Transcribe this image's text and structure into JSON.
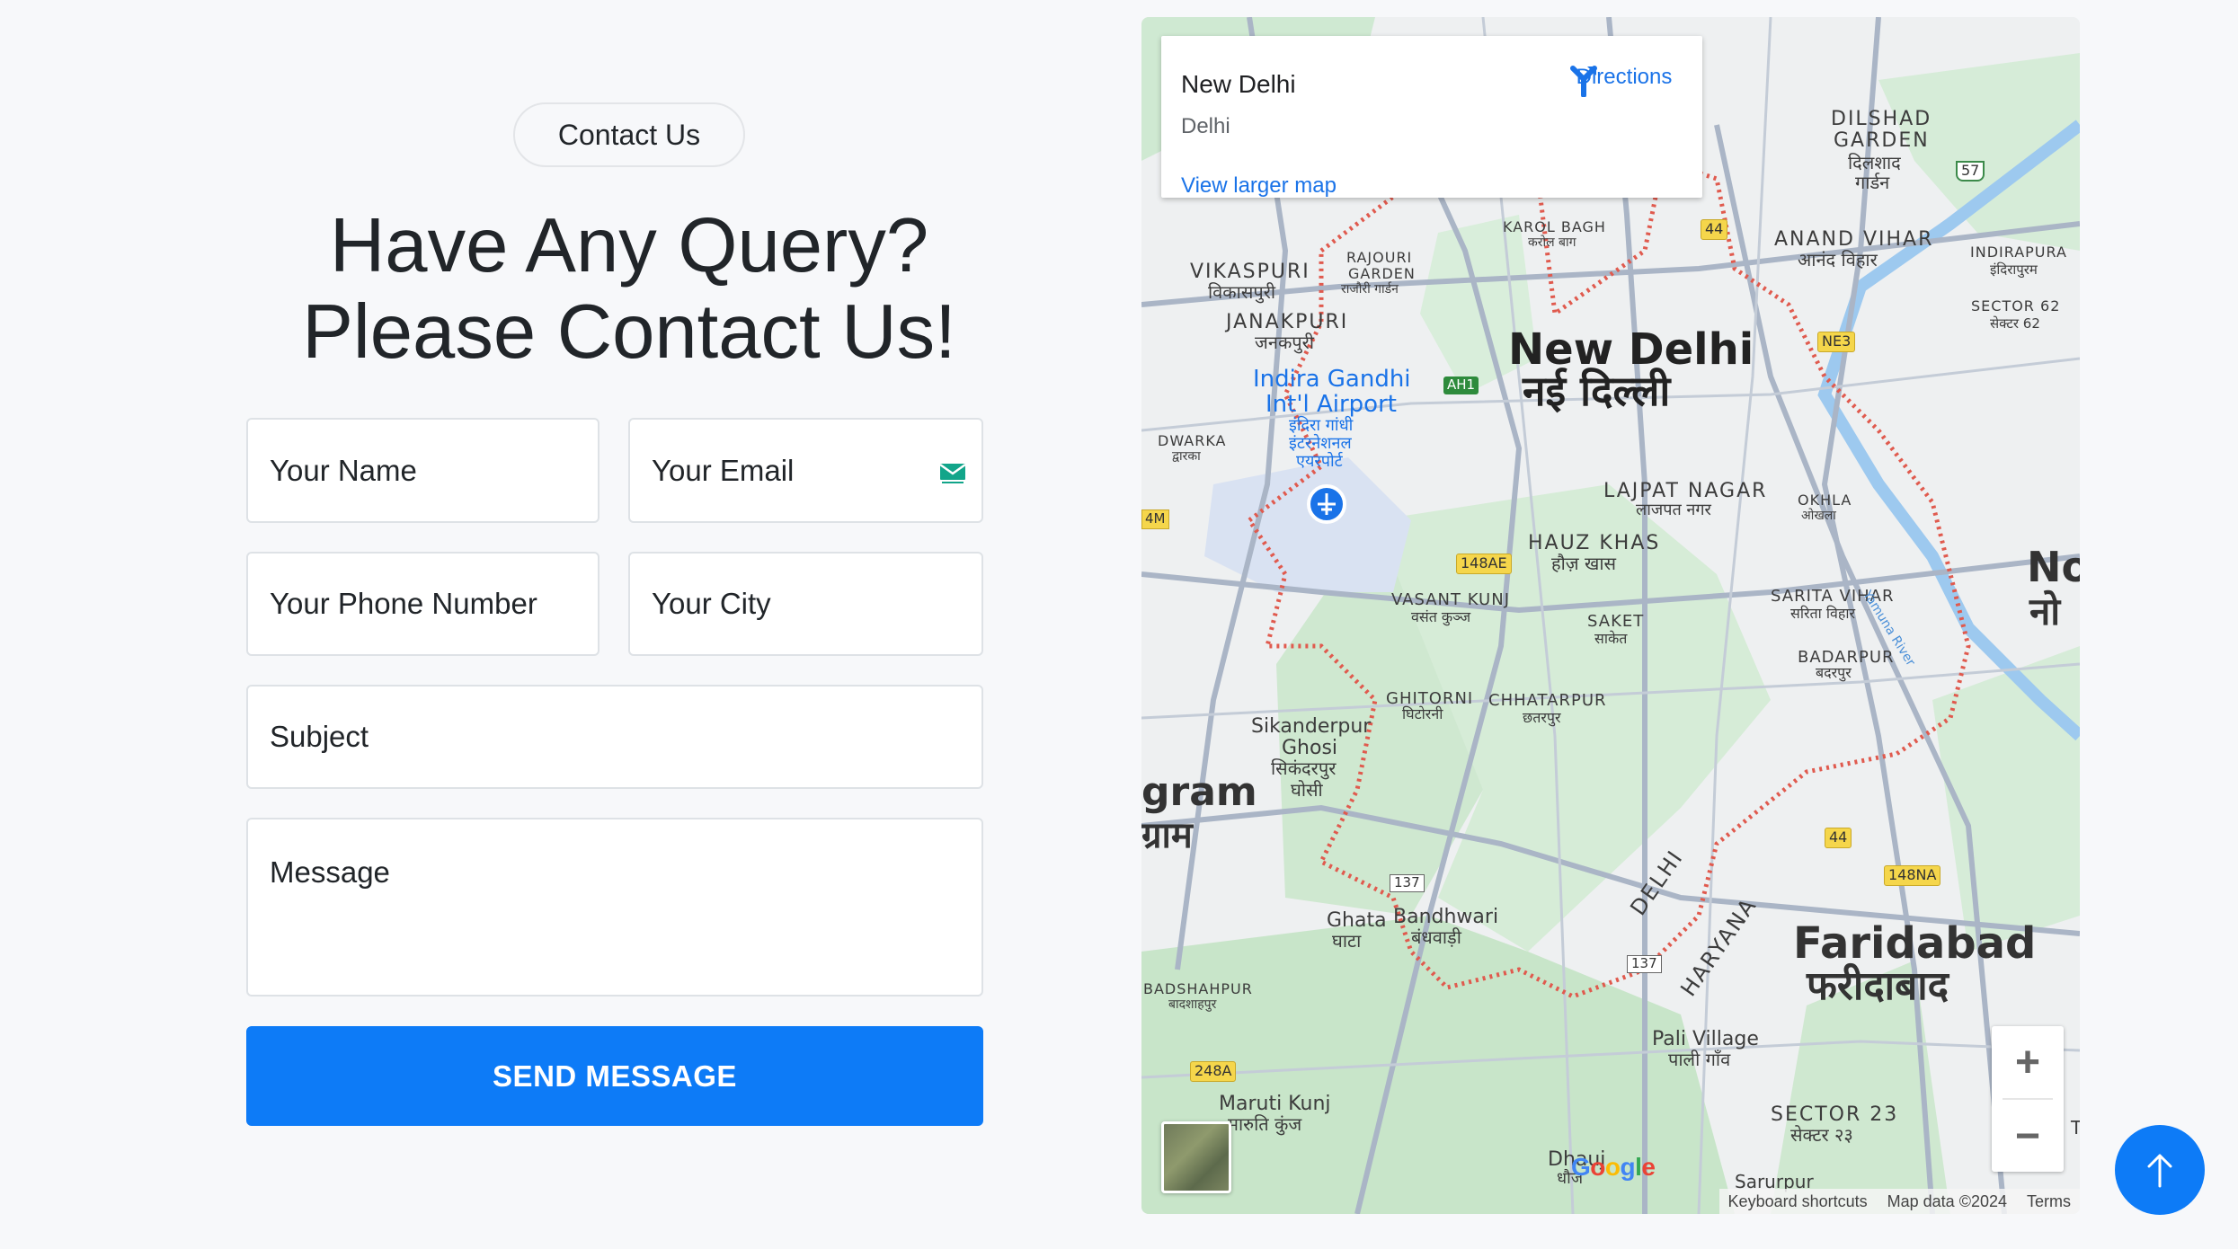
{
  "contact": {
    "badge": "Contact Us",
    "heading_line1": "Have Any Query?",
    "heading_line2": "Please Contact Us!"
  },
  "form": {
    "name_placeholder": "Your Name",
    "email_placeholder": "Your Email",
    "phone_placeholder": "Your Phone Number",
    "city_placeholder": "Your City",
    "subject_placeholder": "Subject",
    "message_placeholder": "Message",
    "email_field_icon": "mail-icon",
    "send_label": "SEND MESSAGE"
  },
  "map": {
    "place_title": "New Delhi",
    "place_subtitle": "Delhi",
    "view_larger": "View larger map",
    "directions_label": "Directions",
    "zoom_in": "+",
    "zoom_out": "−",
    "attribution": {
      "shortcuts": "Keyboard shortcuts",
      "data": "Map data ©2024",
      "terms": "Terms"
    },
    "google": "Google",
    "labels": {
      "new_delhi": "New Delhi",
      "new_delhi_hi": "नई दिल्ली",
      "faridabad": "Faridabad",
      "faridabad_hi": "फरीदाबाद",
      "gurgram": "gram",
      "gurgram_hi": "ग्राम",
      "noida": "No",
      "noida_hi": "नो",
      "dilshad": "DILSHAD",
      "garden": "GARDEN",
      "dilshad_hi": "दिलशाद",
      "garden_hi": "गार्डन",
      "anand_vihar": "ANAND VIHAR",
      "anand_vihar_hi": "आनंद विहार",
      "indirapura": "INDIRAPURA",
      "indirapura_hi": "इंदिरापुरम",
      "sector62": "SECTOR 62",
      "sector62_hi": "सेक्टर 62",
      "karol_bagh": "KAROL BAGH",
      "karol_bagh_hi": "करोल बाग",
      "vikaspuri": "VIKASPURI",
      "vikaspuri_hi": "विकासपुरी",
      "rajouri": "RAJOURI",
      "rajouri2": "GARDEN",
      "rajouri_hi": "राजौरी गार्डन",
      "janakpuri": "JANAKPURI",
      "janakpuri_hi": "जनकपुरी",
      "airport1": "Indira Gandhi",
      "airport2": "Int'l Airport",
      "airport_hi1": "इंदिरा गांधी",
      "airport_hi2": "इंटरनेशनल",
      "airport_hi3": "एयरपोर्ट",
      "dwarka": "DWARKA",
      "dwarka_hi": "द्वारका",
      "lajpat": "LAJPAT NAGAR",
      "lajpat_hi": "लाजपत नगर",
      "okhla": "OKHLA",
      "okhla_hi": "ओखला",
      "hauz_khas": "HAUZ KHAS",
      "hauz_khas_hi": "हौज़ खास",
      "vasant_kunj": "VASANT KUNJ",
      "vasant_kunj_hi": "वसंत कुञ्ज",
      "saket": "SAKET",
      "saket_hi": "साकेत",
      "sarita": "SARITA VIHAR",
      "sarita_hi": "सरिता विहार",
      "badarpur": "BADARPUR",
      "badarpur_hi": "बदरपुर",
      "ghitorni": "GHITORNI",
      "ghitorni_hi": "घिटोरनी",
      "chhatarpur": "CHHATARPUR",
      "chhatarpur_hi": "छतरपुर",
      "sikanderpur1": "Sikanderpur",
      "sikanderpur2": "Ghosi",
      "sikanderpur_hi1": "सिकंदरपुर",
      "sikanderpur_hi2": "घोसी",
      "ghata": "Ghata",
      "ghata_hi": "घाटा",
      "bandhwari": "Bandhwari",
      "bandhwari_hi": "बंधवाड़ी",
      "delhi_border": "DELHI",
      "haryana_border": "HARYANA",
      "yamuna": "Yamuna River",
      "badshahpur": "BADSHAHPUR",
      "badshahpur_hi": "बादशाहपुर",
      "maruti1": "Maruti Kunj",
      "maruti_hi": "मारुति कुंज",
      "pali1": "Pali Village",
      "pali_hi": "पाली गाँव",
      "sector23": "SECTOR 23",
      "sector23_hi": "सेक्टर २३",
      "dhauj": "Dhauj",
      "dhauj_hi": "धौज",
      "sarurpur": "Sarurpur",
      "t_edge": "T"
    },
    "shields": {
      "nh44_top": "44",
      "nh44_bottom": "44",
      "ne3": "NE3",
      "ah1": "AH1",
      "r148ae": "148AE",
      "r148na": "148NA",
      "r137a": "137",
      "r137b": "137",
      "r248a": "248A",
      "r57": "57",
      "m4": "4M"
    }
  },
  "colors": {
    "accent": "#0d7bf7",
    "map_link": "#1a73e8",
    "border_red": "#e05a4e"
  }
}
